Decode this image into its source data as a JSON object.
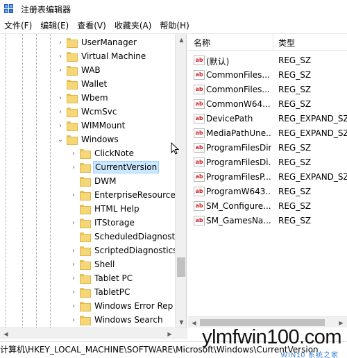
{
  "window": {
    "title": "注册表编辑器"
  },
  "menu": [
    "文件(F)",
    "编辑(E)",
    "查看(V)",
    "收藏夹(A)",
    "帮助(H)"
  ],
  "tree": {
    "items_level1": [
      {
        "label": "UserManager"
      },
      {
        "label": "Virtual Machine"
      },
      {
        "label": "WAB"
      },
      {
        "label": "Wallet"
      },
      {
        "label": "Wbem"
      },
      {
        "label": "WcmSvc"
      },
      {
        "label": "WIMMount"
      },
      {
        "label": "Windows",
        "expanded": true
      }
    ],
    "items_level2": [
      {
        "label": "ClickNote"
      },
      {
        "label": "CurrentVersion",
        "selected": true
      },
      {
        "label": "DWM"
      },
      {
        "label": "EnterpriseResource"
      },
      {
        "label": "HTML Help"
      },
      {
        "label": "ITStorage"
      },
      {
        "label": "ScheduledDiagnost"
      },
      {
        "label": "ScriptedDiagnostics"
      },
      {
        "label": "Shell"
      },
      {
        "label": "Tablet PC"
      },
      {
        "label": "TabletPC"
      },
      {
        "label": "Windows Error Rep"
      },
      {
        "label": "Windows Search"
      }
    ]
  },
  "list": {
    "headers": {
      "name": "名称",
      "type": "类型"
    },
    "rows": [
      {
        "name": "(默认)",
        "type": "REG_SZ"
      },
      {
        "name": "CommonFiles...",
        "type": "REG_SZ"
      },
      {
        "name": "CommonFiles...",
        "type": "REG_SZ"
      },
      {
        "name": "CommonW64...",
        "type": "REG_SZ"
      },
      {
        "name": "DevicePath",
        "type": "REG_EXPAND_SZ"
      },
      {
        "name": "MediaPathUne...",
        "type": "REG_EXPAND_SZ"
      },
      {
        "name": "ProgramFilesDir",
        "type": "REG_SZ"
      },
      {
        "name": "ProgramFilesDi...",
        "type": "REG_SZ"
      },
      {
        "name": "ProgramFilesP...",
        "type": "REG_EXPAND_SZ"
      },
      {
        "name": "ProgramW643...",
        "type": "REG_SZ"
      },
      {
        "name": "SM_Configure...",
        "type": "REG_SZ"
      },
      {
        "name": "SM_GamesNa...",
        "type": "REG_SZ"
      }
    ],
    "icon_text": "ab"
  },
  "status": {
    "path": "计算机\\HKEY_LOCAL_MACHINE\\SOFTWARE\\Microsoft\\Windows\\CurrentVersion"
  },
  "watermark": {
    "main": "ylmfwin100.com",
    "sub": "WIN10 系统之家"
  },
  "icons": {
    "app": "registry-editor-icon",
    "folder": "folder-icon",
    "value": "string-value-icon",
    "cursor": "mouse-cursor-icon"
  },
  "colors": {
    "selection_bg": "#cce8ff",
    "folder": "#f5d778",
    "watermark_sub": "#2d7bd1"
  }
}
